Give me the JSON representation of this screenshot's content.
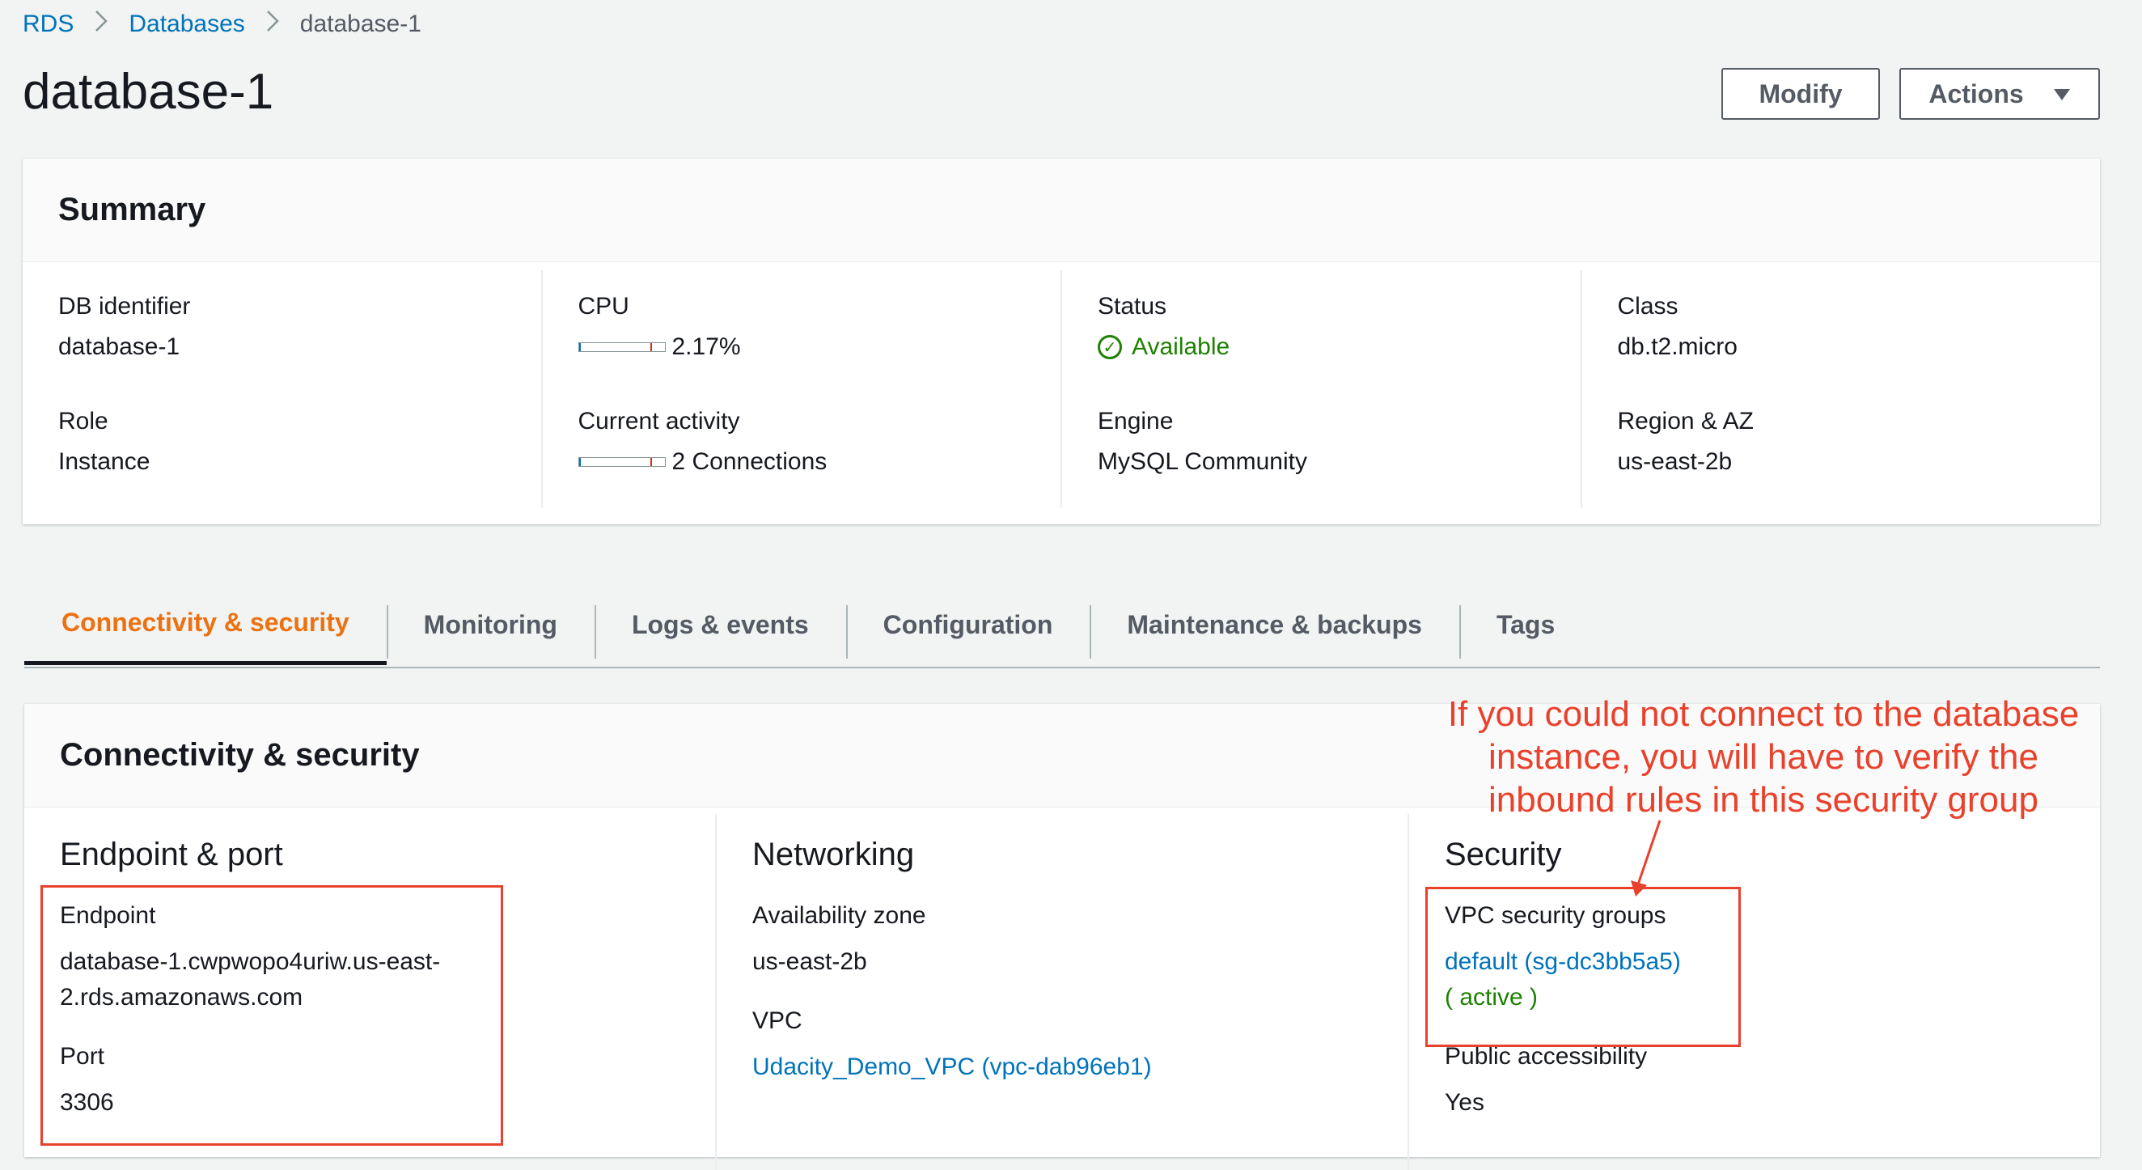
{
  "breadcrumb": {
    "items": [
      "RDS",
      "Databases"
    ],
    "current": "database-1"
  },
  "page_title": "database-1",
  "header_buttons": {
    "modify": "Modify",
    "actions": "Actions"
  },
  "summary": {
    "title": "Summary",
    "fields": {
      "db_identifier": {
        "label": "DB identifier",
        "value": "database-1"
      },
      "role": {
        "label": "Role",
        "value": "Instance"
      },
      "cpu": {
        "label": "CPU",
        "value": "2.17%",
        "level": 0.0217
      },
      "current_activity": {
        "label": "Current activity",
        "value": "2 Connections"
      },
      "status": {
        "label": "Status",
        "value": "Available",
        "icon": "check-circle-icon"
      },
      "engine": {
        "label": "Engine",
        "value": "MySQL Community"
      },
      "class": {
        "label": "Class",
        "value": "db.t2.micro"
      },
      "region_az": {
        "label": "Region & AZ",
        "value": "us-east-2b"
      }
    }
  },
  "tabs": [
    {
      "label": "Connectivity & security",
      "active": true
    },
    {
      "label": "Monitoring"
    },
    {
      "label": "Logs & events"
    },
    {
      "label": "Configuration"
    },
    {
      "label": "Maintenance & backups"
    },
    {
      "label": "Tags"
    }
  ],
  "connectivity": {
    "title": "Connectivity & security",
    "endpoint_port": {
      "heading": "Endpoint & port",
      "endpoint_label": "Endpoint",
      "endpoint_line1": "database-1.cwpwopo4uriw.us-east-",
      "endpoint_line2": "2.rds.amazonaws.com",
      "port_label": "Port",
      "port_value": "3306"
    },
    "networking": {
      "heading": "Networking",
      "az_label": "Availability zone",
      "az_value": "us-east-2b",
      "vpc_label": "VPC",
      "vpc_value": "Udacity_Demo_VPC (vpc-dab96eb1)"
    },
    "security": {
      "heading": "Security",
      "sg_label": "VPC security groups",
      "sg_value": "default (sg-dc3bb5a5)",
      "sg_status": "( active )",
      "public_label": "Public accessibility",
      "public_value": "Yes"
    }
  },
  "annotation": {
    "line1": "If you could not connect to the database",
    "line2": "instance, you will have to verify the",
    "line3": "inbound rules in this security group",
    "color": "#e8412c"
  },
  "colors": {
    "link": "#0073bb",
    "active_tab": "#ec7211",
    "success": "#1d8102"
  }
}
